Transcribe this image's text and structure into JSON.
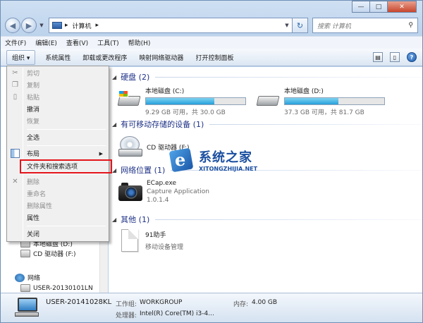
{
  "window": {
    "caption_buttons": [
      "—",
      "□",
      "✕"
    ]
  },
  "address": {
    "back_glyph": "◀",
    "forward_glyph": "▶",
    "segments": [
      "▸",
      "计算机",
      "▸"
    ],
    "refresh_glyph": "↻",
    "search_placeholder": "搜索 计算机",
    "search_icon": "⚲"
  },
  "menubar": {
    "items": [
      "文件(F)",
      "编辑(E)",
      "查看(V)",
      "工具(T)",
      "帮助(H)"
    ]
  },
  "toolbar": {
    "organize": "组织 ▾",
    "items": [
      "系统属性",
      "卸载或更改程序",
      "映射网络驱动器",
      "打开控制面板"
    ],
    "help_glyph": "?"
  },
  "navpane": {
    "items": [
      "本地磁盘 (D:)",
      "CD 驱动器 (F:)",
      "网络",
      "USER-20130101LN"
    ]
  },
  "groups": {
    "hdd": "硬盘 (2)",
    "removable": "有可移动存储的设备 (1)",
    "network": "网络位置 (1)",
    "other": "其他 (1)"
  },
  "drives": [
    {
      "name": "本地磁盘 (C:)",
      "info": "9.29 GB 可用，共 30.0 GB",
      "used_fraction": 0.69
    },
    {
      "name": "本地磁盘 (D:)",
      "info": "37.3 GB 可用，共 81.7 GB",
      "used_fraction": 0.54
    }
  ],
  "cd_drive": {
    "name": "CD 驱动器 (F:)"
  },
  "network_item": {
    "name": "ECap.exe",
    "description": "Capture Application",
    "version": "1.0.1.4"
  },
  "other_item": {
    "name": "91助手",
    "description": "移动设备管理"
  },
  "watermark": {
    "logo_letter": "e",
    "cn": "系统之家",
    "en": "XITONGZHIJIA.NET"
  },
  "details": {
    "name": "USER-20141028KL",
    "workgroup_label": "工作组:",
    "workgroup_value": "WORKGROUP",
    "memory_label": "内存:",
    "memory_value": "4.00 GB",
    "cpu_label": "处理器:",
    "cpu_value": "Intel(R) Core(TM) i3-4..."
  },
  "context_menu": {
    "cut": "剪切",
    "copy": "复制",
    "paste": "粘贴",
    "undo": "撤消",
    "redo": "恢复",
    "select_all": "全选",
    "layout": "布局",
    "folder_options": "文件夹和搜索选项",
    "delete": "删除",
    "rename": "重命名",
    "remove_properties": "删除属性",
    "properties": "属性",
    "close": "关闭",
    "cut_icon": "✂",
    "delete_icon": "✕",
    "submenu_arrow": "▶"
  }
}
